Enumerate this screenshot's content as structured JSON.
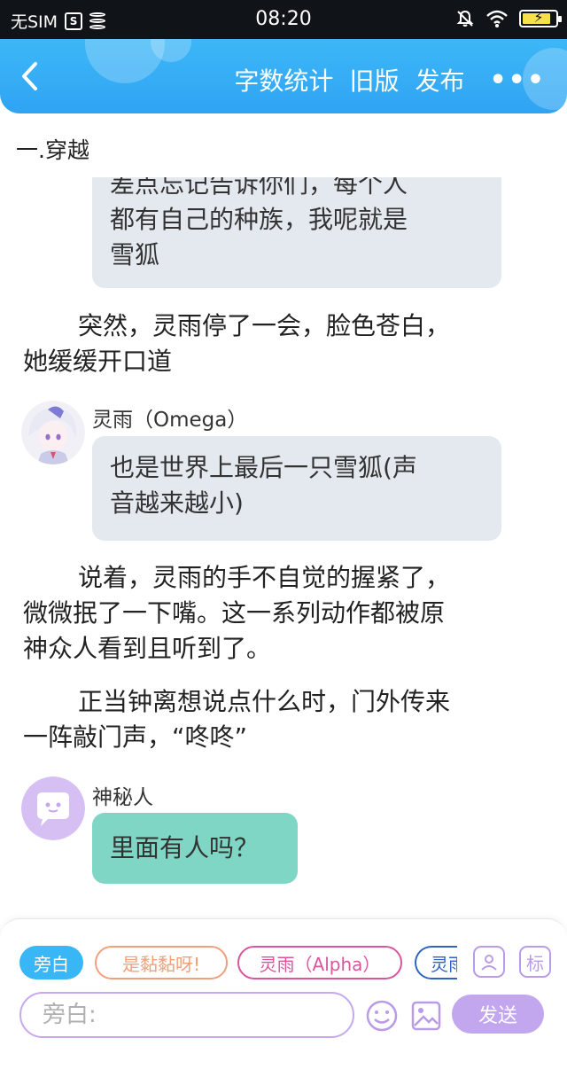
{
  "status_bar": {
    "carrier": "无SIM",
    "sim_icon_label": "S",
    "time": "08:20",
    "icons": [
      "sim-icon",
      "database-icon",
      "mute-icon",
      "wifi-icon",
      "battery-icon"
    ],
    "battery_level": 0.85
  },
  "header": {
    "back_icon": "chevron-left-icon",
    "word_count_label": "字数统计",
    "old_version_label": "旧版",
    "publish_label": "发布",
    "more_label": "•••",
    "colors": {
      "gradient_top": "#3db7f7",
      "gradient_bottom": "#2fa4f3"
    }
  },
  "chapter": {
    "title": "一.穿越"
  },
  "content": {
    "partial_bubble": {
      "text_line1": "差点忘记告诉你们，每个人",
      "text_line2": "都有自己的种族，我呢就是",
      "text_line3": "雪狐"
    },
    "narration_1": {
      "line1": "突然，灵雨停了一会，脸色苍白，",
      "line2": "她缓缓开口道"
    },
    "message_1": {
      "speaker": "灵雨（Omega）",
      "line1": "也是世界上最后一只雪狐(声",
      "line2": "音越来越小)"
    },
    "narration_2": {
      "line1": "说着，灵雨的手不自觉的握紧了，",
      "line2": "微微抿了一下嘴。这一系列动作都被原",
      "line3": "神众人看到且听到了。"
    },
    "narration_3": {
      "line1": "正当钟离想说点什么时，门外传来",
      "line2": "一阵敲门声，“咚咚”"
    },
    "message_2": {
      "speaker": "神秘人",
      "text": "里面有人吗？",
      "bubble_color": "#7fd6c4",
      "avatar_color": "#d6bff2"
    }
  },
  "composer": {
    "chips": [
      {
        "label": "旁白",
        "color": "#39b6f5"
      },
      {
        "label": "是黏黏呀!",
        "color": "#f2a07b"
      },
      {
        "label": "灵雨（Alpha）",
        "color": "#d9559e"
      },
      {
        "label": "灵雨",
        "color": "#2f63c4"
      }
    ],
    "character_icon": "person-icon",
    "tag_label": "标",
    "input_placeholder": "旁白:",
    "emoji_icon": "emoji-icon",
    "image_icon": "image-icon",
    "send_label": "发送",
    "accent_color": "#c3a7ee"
  }
}
